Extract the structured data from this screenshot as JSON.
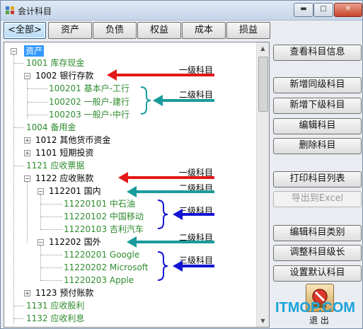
{
  "window": {
    "title": "会计科目",
    "minimize_glyph": "▬",
    "maximize_glyph": "□",
    "close_glyph": "✕"
  },
  "tabs": [
    "<全部>",
    "资产",
    "负债",
    "权益",
    "成本",
    "损益"
  ],
  "tree": {
    "root": "资产",
    "nodes": [
      "1001 库存现金",
      "1002 银行存款",
      "100201 基本户-工行",
      "100202 一般户-建行",
      "100203 一般户-中行",
      "1004 备用金",
      "1012 其他货币资金",
      "1101 短期投资",
      "1121 应收票据",
      "1122 应收账款",
      "112201 国内",
      "11220101 中石油",
      "11220102 中国移动",
      "11220103 吉利汽车",
      "112202 国外",
      "11220201 Google",
      "11220202 Microsoft",
      "11220203 Apple",
      "1123 预付账款",
      "1131 应收股利",
      "1132 应收利息"
    ],
    "expander_plus": "+",
    "expander_minus": "−"
  },
  "annotations": {
    "level1": "一级科目",
    "level2": "二级科目",
    "level3": "三级科目"
  },
  "colors": {
    "level1_arrow": "#e31818",
    "level2_arrow": "#1a9b9b",
    "level3_arrow": "#1414d6"
  },
  "buttons": [
    "查看科目信息",
    "新增同级科目",
    "新增下级科目",
    "编辑科目",
    "删除科目",
    "打印科目列表",
    "导出到Excel",
    "编辑科目类别",
    "调整科目级长",
    "设置默认科目"
  ],
  "exit_label": "退 出",
  "watermark": "ITMOP.COM",
  "scroll": {
    "up": "▲",
    "down": "▼"
  }
}
